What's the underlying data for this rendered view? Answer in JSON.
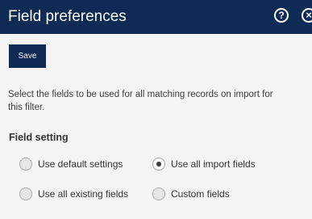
{
  "dialog": {
    "title": "Field preferences",
    "help_icon": "?",
    "close_icon": "×"
  },
  "toolbar": {
    "save_label": "Save"
  },
  "description": {
    "line1": "Select the fields to be used for all matching records on import for",
    "line2": "this filter."
  },
  "field_setting": {
    "label": "Field setting",
    "options": [
      {
        "label": "Use default settings",
        "checked": false
      },
      {
        "label": "Use all import fields",
        "checked": true
      },
      {
        "label": "Use all existing fields",
        "checked": false
      },
      {
        "label": "Custom fields",
        "checked": false
      }
    ]
  },
  "colors": {
    "header_bg": "#0f2a55",
    "panel_bg": "#f4f4f4",
    "text": "#333333"
  }
}
